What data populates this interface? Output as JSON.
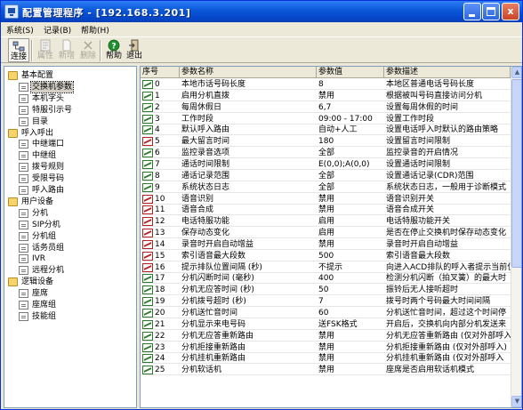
{
  "window": {
    "title": "配置管理程序 - [192.168.3.201]",
    "minimize_label": "",
    "close_label": "x"
  },
  "menu": [
    "系统(S)",
    "记录(B)",
    "帮助(H)"
  ],
  "toolbar": {
    "connect": "连接",
    "properties": "属性",
    "add": "新增",
    "delete": "删除",
    "help": "帮助",
    "exit": "退出"
  },
  "tree": [
    {
      "label": "基本配置",
      "level": 0,
      "type": "folder"
    },
    {
      "label": "交换机参数",
      "level": 1,
      "type": "doc",
      "selected": true
    },
    {
      "label": "本机字头",
      "level": 1,
      "type": "doc"
    },
    {
      "label": "特服引示号",
      "level": 1,
      "type": "doc"
    },
    {
      "label": "目录",
      "level": 1,
      "type": "doc"
    },
    {
      "label": "呼入呼出",
      "level": 0,
      "type": "folder"
    },
    {
      "label": "中继端口",
      "level": 1,
      "type": "doc"
    },
    {
      "label": "中继组",
      "level": 1,
      "type": "doc"
    },
    {
      "label": "拨号规则",
      "level": 1,
      "type": "doc"
    },
    {
      "label": "受限号码",
      "level": 1,
      "type": "doc"
    },
    {
      "label": "呼入路由",
      "level": 1,
      "type": "doc"
    },
    {
      "label": "用户设备",
      "level": 0,
      "type": "folder"
    },
    {
      "label": "分机",
      "level": 1,
      "type": "doc"
    },
    {
      "label": "SIP分机",
      "level": 1,
      "type": "doc"
    },
    {
      "label": "分机组",
      "level": 1,
      "type": "doc"
    },
    {
      "label": "话务员组",
      "level": 1,
      "type": "doc"
    },
    {
      "label": "IVR",
      "level": 1,
      "type": "doc"
    },
    {
      "label": "远程分机",
      "level": 1,
      "type": "doc"
    },
    {
      "label": "逻辑设备",
      "level": 0,
      "type": "folder"
    },
    {
      "label": "座席",
      "level": 1,
      "type": "doc"
    },
    {
      "label": "座席组",
      "level": 1,
      "type": "doc"
    },
    {
      "label": "技能组",
      "level": 1,
      "type": "doc"
    }
  ],
  "grid": {
    "columns": [
      "序号",
      "参数名称",
      "参数值",
      "参数描述"
    ],
    "rows": [
      {
        "no": "0",
        "name": "本地市话号码长度",
        "value": "8",
        "desc": "本地区普通电话号码长度",
        "icon": "green"
      },
      {
        "no": "1",
        "name": "启用分机直拨",
        "value": "禁用",
        "desc": "根据被叫号码直接访问分机",
        "icon": "green"
      },
      {
        "no": "2",
        "name": "每周休假日",
        "value": "6,7",
        "desc": "设置每周休假的时间",
        "icon": "green"
      },
      {
        "no": "3",
        "name": "工作时段",
        "value": "09:00 - 17:00",
        "desc": "设置工作时段",
        "icon": "green"
      },
      {
        "no": "4",
        "name": "默认呼入路由",
        "value": "自动+人工",
        "desc": "设置电话呼入时默认的路由策略",
        "icon": "green"
      },
      {
        "no": "5",
        "name": "最大留言时间",
        "value": "180",
        "desc": "设置留言时间限制",
        "icon": "red"
      },
      {
        "no": "6",
        "name": "监控录音选项",
        "value": "全部",
        "desc": "监控录音的开启情况",
        "icon": "green"
      },
      {
        "no": "7",
        "name": "通话时间限制",
        "value": "E(0,0);A(0,0)",
        "desc": "设置通话时间限制",
        "icon": "green"
      },
      {
        "no": "8",
        "name": "通话记录范围",
        "value": "全部",
        "desc": "设置通话记录(CDR)范围",
        "icon": "green"
      },
      {
        "no": "9",
        "name": "系统状态日志",
        "value": "全部",
        "desc": "系统状态日志，一般用于诊断模式",
        "icon": "green"
      },
      {
        "no": "10",
        "name": "语音识别",
        "value": "禁用",
        "desc": "语音识别开关",
        "icon": "red"
      },
      {
        "no": "11",
        "name": "语音合成",
        "value": "禁用",
        "desc": "语音合成开关",
        "icon": "red"
      },
      {
        "no": "12",
        "name": "电话特服功能",
        "value": "启用",
        "desc": "电话特服功能开关",
        "icon": "red"
      },
      {
        "no": "13",
        "name": "保存动态变化",
        "value": "启用",
        "desc": "是否在停止交换机时保存动态变化",
        "icon": "red"
      },
      {
        "no": "14",
        "name": "录音时开启自动增益",
        "value": "禁用",
        "desc": "录音时开启自动增益",
        "icon": "red"
      },
      {
        "no": "15",
        "name": "索引语音最大段数",
        "value": "500",
        "desc": "索引语音最大段数",
        "icon": "red"
      },
      {
        "no": "16",
        "name": "提示排队位置间隔 (秒)",
        "value": "不提示",
        "desc": "向进入ACD排队的呼入者提示当前位",
        "icon": "red"
      },
      {
        "no": "17",
        "name": "分机闪断时间 (毫秒)",
        "value": "400",
        "desc": "检测分机闪断（拍叉簧）的最大时",
        "icon": "green"
      },
      {
        "no": "18",
        "name": "分机无应答时间 (秒)",
        "value": "50",
        "desc": "振铃后无人接听超时",
        "icon": "green"
      },
      {
        "no": "19",
        "name": "分机拨号超时 (秒)",
        "value": "7",
        "desc": "拨号时两个号码最大时间间隔",
        "icon": "green"
      },
      {
        "no": "20",
        "name": "分机送忙音时间",
        "value": "60",
        "desc": "分机送忙音时间，超过这个时间停",
        "icon": "green"
      },
      {
        "no": "21",
        "name": "分机显示来电号码",
        "value": "送FSK格式",
        "desc": "开启后，交换机向内部分机发送来",
        "icon": "green"
      },
      {
        "no": "22",
        "name": "分机无应答重新路由",
        "value": "禁用",
        "desc": "分机无应答重新路由 (仅对外部呼入",
        "icon": "green"
      },
      {
        "no": "23",
        "name": "分机拒接重新路由",
        "value": "禁用",
        "desc": "分机拒接重新路由 (仅对外部呼入)",
        "icon": "green"
      },
      {
        "no": "24",
        "name": "分机挂机重新路由",
        "value": "禁用",
        "desc": "分机挂机重新路由 (仅对外部呼入",
        "icon": "green"
      },
      {
        "no": "25",
        "name": "分机软话机",
        "value": "禁用",
        "desc": "座席是否启用软话机模式",
        "icon": "green"
      }
    ]
  },
  "colors": {
    "titlebar": "#0a57d8",
    "window_bg": "#ece9d8",
    "icon_green": "#2a7a2a",
    "icon_red": "#b22222"
  }
}
